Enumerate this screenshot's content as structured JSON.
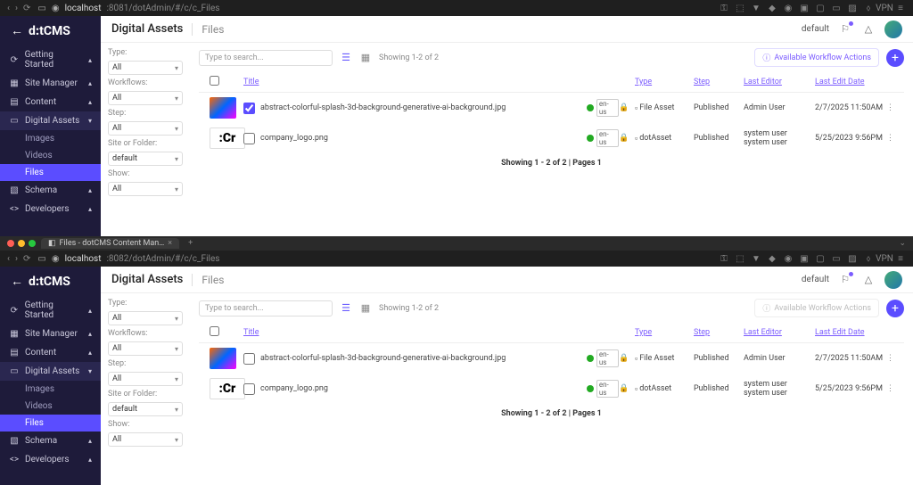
{
  "browser": {
    "url_host": "localhost",
    "url_port1": ":8081",
    "url_port2": ":8082",
    "url_path": "/dotAdmin/#/c/c_Files",
    "tab_title": "Files - dotCMS Content Man…",
    "vpn": "VPN"
  },
  "brand": "dotCMS",
  "crumbs": {
    "section": "Digital Assets",
    "page": "Files",
    "persona": "default"
  },
  "sidebar": {
    "items": [
      {
        "icon": "⟳",
        "label": "Getting Started"
      },
      {
        "icon": "▦",
        "label": "Site Manager"
      },
      {
        "icon": "▤",
        "label": "Content"
      },
      {
        "icon": "▭",
        "label": "Digital Assets"
      },
      {
        "icon": "▧",
        "label": "Schema"
      },
      {
        "icon": "<>",
        "label": "Developers"
      }
    ],
    "sub": [
      "Images",
      "Videos",
      "Files"
    ]
  },
  "filters": {
    "type_label": "Type:",
    "workflows_label": "Workflows:",
    "step_label": "Step:",
    "folder_label": "Site or Folder:",
    "show_label": "Show:",
    "all": "All",
    "default": "default"
  },
  "toolbar": {
    "search_placeholder": "Type to search...",
    "showing": "Showing 1-2 of 2",
    "wf_label": "Available Workflow Actions",
    "plus": "+"
  },
  "columns": {
    "title": "Title",
    "type": "Type",
    "step": "Step",
    "editor": "Last Editor",
    "date": "Last Edit Date"
  },
  "rows": [
    {
      "title": "abstract-colorful-splash-3d-background-generative-ai-background.jpg",
      "lang": "en-us",
      "type_icon": "▫",
      "type": "File Asset",
      "step": "Published",
      "editor": "Admin User",
      "date": "2/7/2025 11:50AM",
      "thumb": "img"
    },
    {
      "title": "company_logo.png",
      "lang": "en-us",
      "type_icon": "▫",
      "type": "dotAsset",
      "step": "Published",
      "editor": "system user system user",
      "date": "5/25/2023 9:56PM",
      "thumb": "logo"
    }
  ],
  "pager": "Showing 1 - 2 of 2 | Pages 1",
  "logo_text": ":Cr"
}
